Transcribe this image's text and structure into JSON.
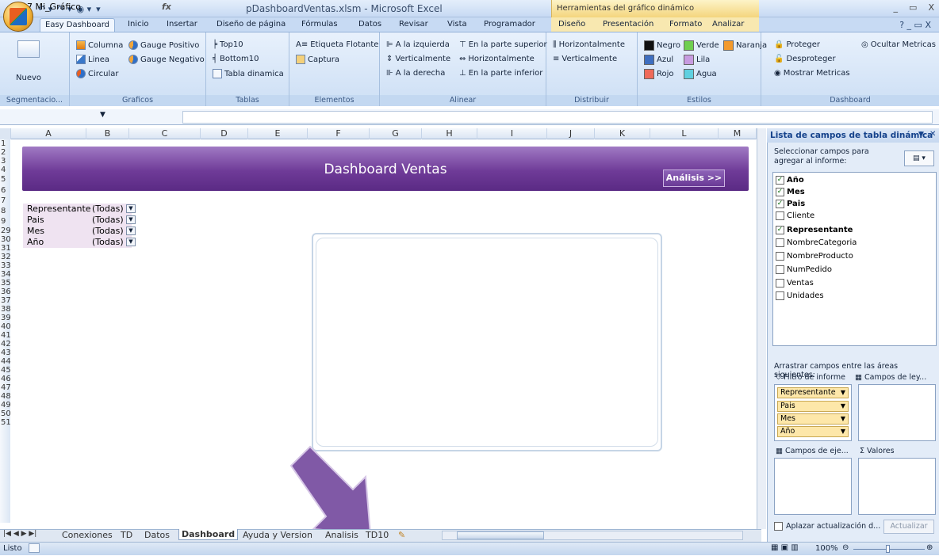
{
  "window": {
    "title": "pDashboardVentas.xlsm - Microsoft Excel",
    "context_title": "Herramientas del gráfico dinámico",
    "controls": [
      "_",
      "▭",
      "X"
    ]
  },
  "tabs": [
    "Easy Dashboard",
    "Inicio",
    "Insertar",
    "Diseño de página",
    "Fórmulas",
    "Datos",
    "Revisar",
    "Vista",
    "Programador",
    "Diseño",
    "Presentación",
    "Formato",
    "Analizar"
  ],
  "ribbon": {
    "segmentacion": {
      "label": "Segmentacio...",
      "nuevo": "Nuevo"
    },
    "graficos": {
      "label": "Graficos",
      "items": [
        "Columna",
        "Linea",
        "Circular",
        "Gauge Positivo",
        "Gauge Negativo"
      ]
    },
    "tablas": {
      "label": "Tablas",
      "items": [
        "Top10",
        "Bottom10",
        "Tabla dinamica"
      ]
    },
    "elementos": {
      "label": "Elementos",
      "items": [
        "Etiqueta Flotante",
        "Captura"
      ]
    },
    "alinear": {
      "label": "Alinear",
      "items": [
        "A la izquierda",
        "Verticalmente",
        "A la derecha",
        "En la parte superior",
        "Horizontalmente",
        "En la parte inferior"
      ]
    },
    "distribuir": {
      "label": "Distribuir",
      "items": [
        "Horizontalmente",
        "Verticalmente"
      ]
    },
    "estilos": {
      "label": "Estilos",
      "items": [
        {
          "name": "Negro",
          "color": "#111111"
        },
        {
          "name": "Verde",
          "color": "#6fcf50"
        },
        {
          "name": "Naranja",
          "color": "#f39a2c"
        },
        {
          "name": "Azul",
          "color": "#3f6fc0"
        },
        {
          "name": "Lila",
          "color": "#c79be0"
        },
        {
          "name": "Rojo",
          "color": "#ef6a5a"
        },
        {
          "name": "Agua",
          "color": "#5fd0e0"
        }
      ]
    },
    "dashboard": {
      "label": "Dashboard",
      "items": [
        "Proteger",
        "Desproteger",
        "Mostrar Metricas",
        "Ocultar Metricas"
      ]
    }
  },
  "formula_bar": {
    "name_box": "7 Mi_Gráfico",
    "fx": "fx",
    "content": ""
  },
  "columns": [
    "A",
    "B",
    "C",
    "D",
    "E",
    "F",
    "G",
    "H",
    "I",
    "J",
    "K",
    "L",
    "M"
  ],
  "rows": [
    "1",
    "2",
    "3",
    "4",
    "5",
    "6",
    "7",
    "8",
    "9",
    "29",
    "30",
    "31",
    "32",
    "33",
    "34",
    "35",
    "36",
    "37",
    "38",
    "39",
    "40",
    "41",
    "42",
    "43",
    "44",
    "45",
    "46",
    "47",
    "48",
    "49",
    "50",
    "51"
  ],
  "dashboard": {
    "title": "Dashboard Ventas",
    "analisis_button": "Análisis >>",
    "filters": [
      {
        "field": "Representante",
        "value": "(Todas)"
      },
      {
        "field": "Pais",
        "value": "(Todas)"
      },
      {
        "field": "Mes",
        "value": "(Todas)"
      },
      {
        "field": "Año",
        "value": "(Todas)"
      }
    ]
  },
  "sheet_tabs": [
    "Conexiones",
    "TD",
    "Datos",
    "Dashboard",
    "Ayuda y Version",
    "Analisis",
    "TD10"
  ],
  "active_sheet": "Dashboard",
  "status": {
    "ready": "Listo",
    "zoom": "100%"
  },
  "pivot_panel": {
    "title": "Lista de campos de tabla dinámica",
    "description": "Seleccionar campos para agregar al informe:",
    "fields": [
      {
        "name": "Año",
        "checked": true
      },
      {
        "name": "Mes",
        "checked": true
      },
      {
        "name": "Pais",
        "checked": true
      },
      {
        "name": "Cliente",
        "checked": false
      },
      {
        "name": "Representante",
        "checked": true
      },
      {
        "name": "NombreCategoria",
        "checked": false
      },
      {
        "name": "NombreProducto",
        "checked": false
      },
      {
        "name": "NumPedido",
        "checked": false
      },
      {
        "name": "Ventas",
        "checked": false
      },
      {
        "name": "Unidades",
        "checked": false
      }
    ],
    "drag_label": "Arrastrar campos entre las áreas siguientes:",
    "filter_area": "Filtro de informe",
    "legend_area": "Campos de ley...",
    "axis_area": "Campos de eje...",
    "values_area": "Valores",
    "filter_items": [
      "Representante",
      "Pais",
      "Mes",
      "Año"
    ],
    "defer": "Aplazar actualización d...",
    "update": "Actualizar"
  }
}
